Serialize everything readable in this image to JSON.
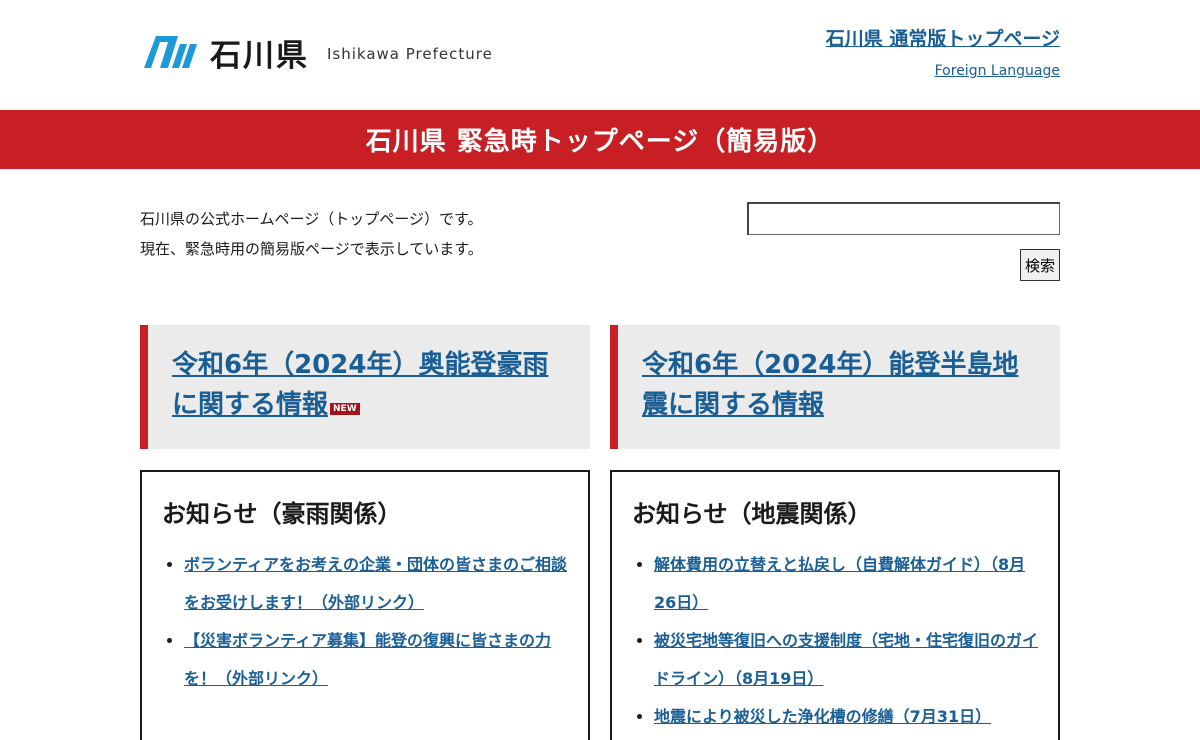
{
  "header": {
    "logo_text": "石川県",
    "logo_en": "Ishikawa Prefecture",
    "top_link": "石川県 通常版トップページ",
    "lang_link": "Foreign Language"
  },
  "banner": {
    "title": "石川県 緊急時トップページ（簡易版）"
  },
  "intro": {
    "line1": "石川県の公式ホームページ（トップページ）です。",
    "line2": "現在、緊急時用の簡易版ページで表示しています。"
  },
  "search": {
    "value": "",
    "button_label": "検索"
  },
  "features": [
    {
      "title": "令和6年（2024年）奥能登豪雨に関する情報",
      "badge": "NEW"
    },
    {
      "title": "令和6年（2024年）能登半島地震に関する情報"
    }
  ],
  "notices": [
    {
      "heading": "お知らせ（豪雨関係）",
      "items": [
        "ボランティアをお考えの企業・団体の皆さまのご相談をお受けします！（外部リンク）",
        "【災害ボランティア募集】能登の復興に皆さまの力を！（外部リンク）"
      ]
    },
    {
      "heading": "お知らせ（地震関係）",
      "items": [
        "解体費用の立替えと払戻し（自費解体ガイド）（8月26日）",
        "被災宅地等復旧への支援制度（宅地・住宅復旧のガイドライン）（8月19日）",
        "地震により被災した浄化槽の修繕（7月31日）"
      ]
    }
  ],
  "colors": {
    "accent_red": "#c71f24",
    "link_blue": "#1a5e96",
    "logo_blue": "#1a9ad6",
    "feature_bg": "#ebebeb"
  }
}
